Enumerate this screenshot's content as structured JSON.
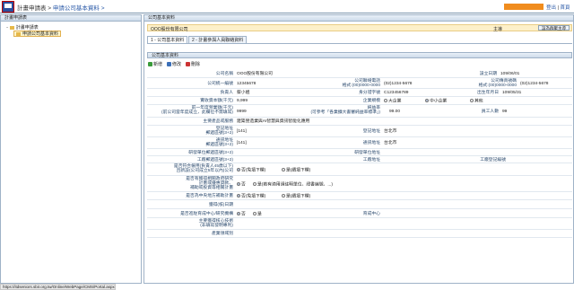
{
  "header": {
    "breadcrumb": [
      "計畫申請表 >",
      "申請公司基本資料 >"
    ],
    "user_links": [
      "登出",
      "首頁"
    ]
  },
  "left": {
    "title": "計畫申請表",
    "tree_root": "計畫申請表",
    "tree_child": "申請公司基本資料"
  },
  "right": {
    "title": "公司基本資料",
    "company_name": "OOO股份有限公司",
    "owner_label": "主導",
    "set_owner_button": "設為群聚主導",
    "tabs": [
      "1 - 公司基本資料",
      "2 - 計畫參與人員聯絡資料"
    ],
    "inner_title": "公司基本資料",
    "toolbar": {
      "add": "新增",
      "edit": "修改",
      "delete": "刪除"
    }
  },
  "form": {
    "company": {
      "label": "公司名稱",
      "value": "OOO股份有限公司",
      "est_label": "設立日期",
      "est_value": "109/06/01"
    },
    "tax": {
      "label": "公司統一編號",
      "value": "12345678",
      "phone_label": "公司聯絡電話\n格式:(00)0000-0000",
      "phone_value": "(02)1234-5678",
      "fax_label": "公司傳真號碼\n格式:(00)0000-0000",
      "fax_value": "(02)1234-5678"
    },
    "person": {
      "label": "負責人",
      "value": "蔡小姐",
      "id_label": "身分證字號",
      "id_value": "C123456789",
      "birth_label": "出生年月日",
      "birth_value": "109/05/31"
    },
    "capital": {
      "label": "實收資本額(千元)",
      "value": "9,999",
      "type_label": "企業規模",
      "options": [
        "大企業",
        "中小企業",
        "其他"
      ],
      "selected": 1
    },
    "revenue": {
      "label": "前一年度營業額(千元)\n(前公司當年度成立，此欄位不需填寫)",
      "value": "9999",
      "profit_label": "純益率\n(可參考「各業擴大書審純益率標準」)",
      "profit_value": "99.00",
      "staff_label": "員工人數",
      "staff_value": "99"
    },
    "products": {
      "label": "主要產品或服務",
      "value": "建築營造業與AI智慧與資訊智能化應用"
    },
    "reg_addr": {
      "label": "登記地址\n郵遞區號(3+2)",
      "zip": "[141]",
      "city_label": "登記地址",
      "city_value": "台北市"
    },
    "contact_addr": {
      "label": "通訊地址\n郵遞區號(3+2)",
      "zip": "[141]",
      "city_label": "通訊地址",
      "city_value": "台北市"
    },
    "rnd_addr": {
      "label": "研發單位郵遞區號(3+2)",
      "city_label": "研發單位地址"
    },
    "factory": {
      "label": "工廠郵遞區號(3+2)",
      "addr_label": "工廠地址",
      "reg_label": "工廠登記編號"
    },
    "hire": {
      "label": "是否符合僱用(負責人45歲以下)\n且新設(公司成立5年以內)公司",
      "options": [
        "否(免填下欄)",
        "是(續填下欄)"
      ],
      "selected": 0
    },
    "loan": {
      "label": "是否有獲得相關政府研究\n計畫或優惠貸款、\n補助或投資等相關計畫",
      "options": [
        "否",
        "是(若有適用請註明單位、證書編號、...)"
      ],
      "selected": 0
    },
    "plan": {
      "label": "是否為中央地方補助計畫",
      "options": [
        "否(免填下欄)",
        "是(續填下欄)"
      ],
      "selected": 0
    },
    "invest": {
      "label": "獲得(核)日期"
    },
    "incubate": {
      "label": "是否進駐育成中心/研究機構",
      "options": [
        "否",
        "是"
      ],
      "selected": 0,
      "center_label": "育成中心"
    },
    "pending": {
      "label": "主要獲得核心技術\n(非填寫發明專利)"
    },
    "award": {
      "label": "產業領域別"
    }
  },
  "status_bar": "https://itdseniors.sbir.org.tw/Online/WebPage/CMS/Portal.aspx"
}
